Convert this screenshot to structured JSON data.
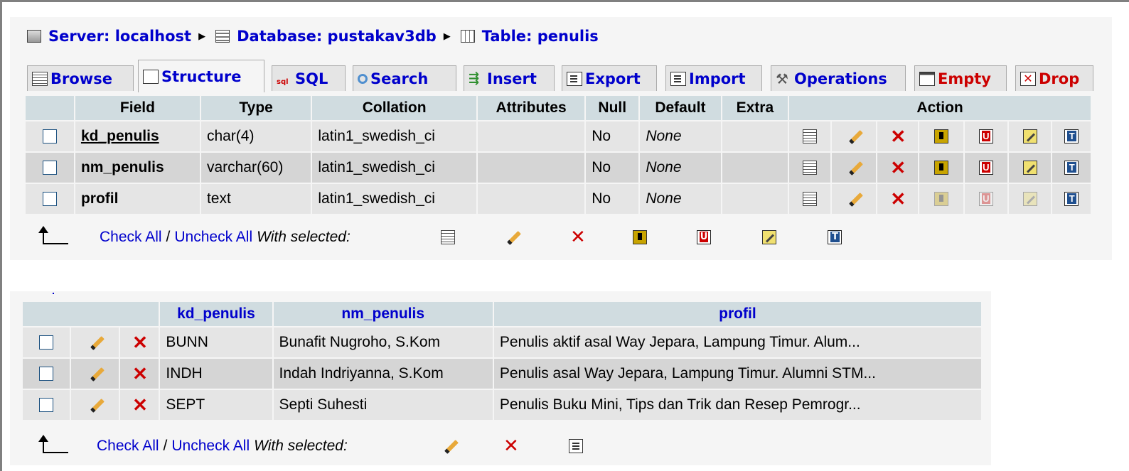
{
  "breadcrumb": {
    "server": "Server: localhost",
    "database": "Database: pustakav3db",
    "table": "Table: penulis"
  },
  "tabs": [
    {
      "label": "Browse",
      "icon": "browse-icon"
    },
    {
      "label": "Structure",
      "icon": "structure-icon"
    },
    {
      "label": "SQL",
      "icon": "sql-icon"
    },
    {
      "label": "Search",
      "icon": "search-icon"
    },
    {
      "label": "Insert",
      "icon": "insert-icon"
    },
    {
      "label": "Export",
      "icon": "export-icon"
    },
    {
      "label": "Import",
      "icon": "import-icon"
    },
    {
      "label": "Operations",
      "icon": "operations-icon"
    },
    {
      "label": "Empty",
      "icon": "empty-icon"
    },
    {
      "label": "Drop",
      "icon": "drop-icon"
    }
  ],
  "structure": {
    "headers": {
      "field": "Field",
      "type": "Type",
      "collation": "Collation",
      "attributes": "Attributes",
      "null": "Null",
      "default": "Default",
      "extra": "Extra",
      "action": "Action"
    },
    "rows": [
      {
        "field": "kd_penulis",
        "type": "char(4)",
        "collation": "latin1_swedish_ci",
        "attributes": "",
        "null": "No",
        "default": "None",
        "extra": ""
      },
      {
        "field": "nm_penulis",
        "type": "varchar(60)",
        "collation": "latin1_swedish_ci",
        "attributes": "",
        "null": "No",
        "default": "None",
        "extra": ""
      },
      {
        "field": "profil",
        "type": "text",
        "collation": "latin1_swedish_ci",
        "attributes": "",
        "null": "No",
        "default": "None",
        "extra": ""
      }
    ],
    "footer": {
      "check_all": "Check All",
      "separator": "/",
      "uncheck_all": "Uncheck All",
      "with_selected": "With selected:"
    }
  },
  "data": {
    "headers": {
      "kd_penulis": "kd_penulis",
      "nm_penulis": "nm_penulis",
      "profil": "profil"
    },
    "rows": [
      {
        "kd_penulis": "BUNN",
        "nm_penulis": "Bunafit Nugroho, S.Kom",
        "profil": "Penulis aktif asal Way Jepara, Lampung Timur. Alum..."
      },
      {
        "kd_penulis": "INDH",
        "nm_penulis": "Indah Indriyanna, S.Kom",
        "profil": "Penulis asal Way Jepara, Lampung Timur. Alumni STM..."
      },
      {
        "kd_penulis": "SEPT",
        "nm_penulis": "Septi Suhesti",
        "profil": "Penulis Buku Mini, Tips dan Trik dan Resep Pemrogr..."
      }
    ],
    "footer": {
      "check_all": "Check All",
      "separator": "/",
      "uncheck_all": "Uncheck All",
      "with_selected": "With selected:"
    }
  },
  "colors": {
    "link": "#0000cc",
    "header_bg": "#d0dce0",
    "row_odd": "#e5e5e5",
    "row_even": "#d5d5d5",
    "delete": "#cc0000"
  }
}
